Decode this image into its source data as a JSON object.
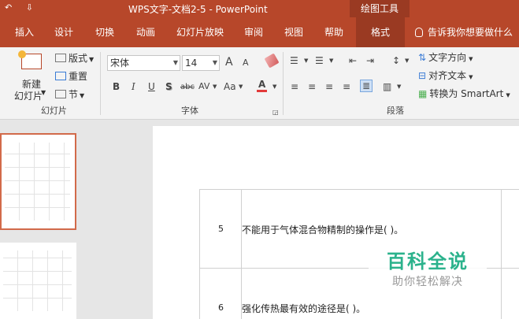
{
  "titlebar": {
    "title": "WPS文字-文档2-5  -  PowerPoint",
    "tool_tab": "绘图工具",
    "qa_icons": [
      "↶",
      "⇩"
    ]
  },
  "tabs": [
    {
      "label": "插入"
    },
    {
      "label": "设计"
    },
    {
      "label": "切换"
    },
    {
      "label": "动画"
    },
    {
      "label": "幻灯片放映"
    },
    {
      "label": "审阅"
    },
    {
      "label": "视图"
    },
    {
      "label": "帮助"
    },
    {
      "label": "格式"
    }
  ],
  "tellme": "告诉我你想要做什么",
  "ribbon": {
    "slides": {
      "new_slide": "新建",
      "new_slide_2": "幻灯片",
      "layout": "版式",
      "reset": "重置",
      "section": "节",
      "group_label": "幻灯片"
    },
    "font": {
      "font_name": "宋体",
      "font_size": "14",
      "group_label": "字体",
      "bold": "B",
      "italic": "I",
      "underline": "U",
      "shadow": "S",
      "strike": "abc",
      "spacing": "AV",
      "case": "Aa",
      "color": "A",
      "grow": "A",
      "shrink": "A"
    },
    "paragraph": {
      "text_direction": "文字方向",
      "align_text": "对齐文本",
      "smartart": "转换为 SmartArt",
      "group_label": "段落"
    }
  },
  "slide_table": {
    "rows": [
      {
        "num": "5",
        "text": "不能用于气体混合物精制的操作是(        )。"
      },
      {
        "num": "6",
        "text": "强化传热最有效的途径是(        )。"
      }
    ]
  },
  "watermark": {
    "main": "百科全说",
    "sub": "助你轻松解决"
  }
}
